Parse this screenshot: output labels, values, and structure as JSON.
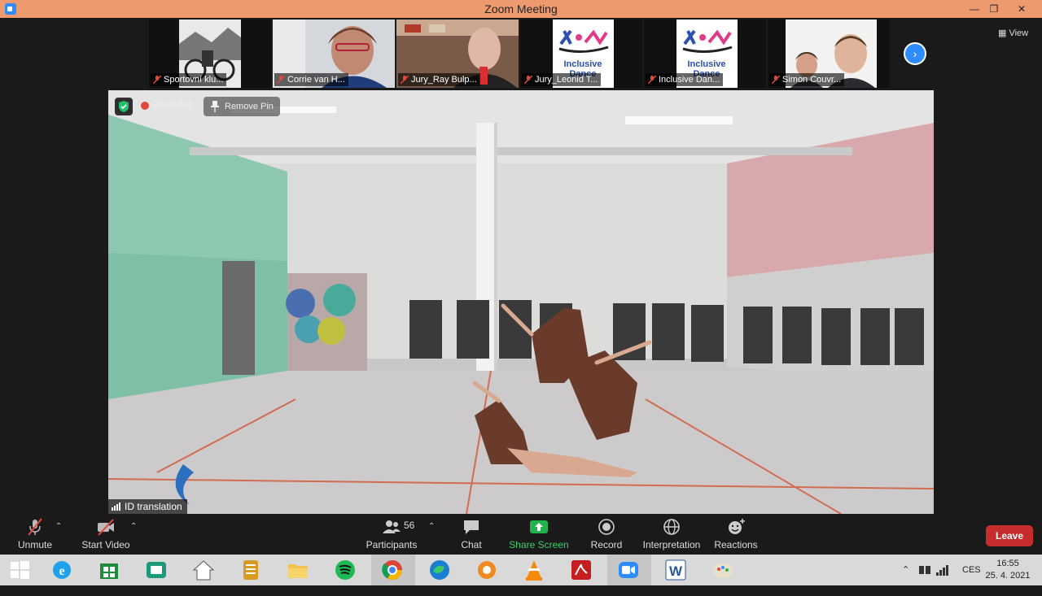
{
  "window": {
    "title": "Zoom Meeting",
    "minimize": "—",
    "restore": "❐",
    "close": "✕"
  },
  "participants_strip": {
    "tiles": [
      {
        "name": "Sportovní klu..."
      },
      {
        "name": "Corrie van H..."
      },
      {
        "name": "Jury_Ray Bulp..."
      },
      {
        "name": "Jury_Leonid T..."
      },
      {
        "name": "Inclusive Dan..."
      },
      {
        "name": "Simon Couvr..."
      }
    ],
    "logo_text": [
      "Inclusive",
      "Dance"
    ],
    "view_label": "View",
    "next_label": "›"
  },
  "main_video": {
    "recording_label": "Recording",
    "remove_pin_label": "Remove Pin",
    "speaker_name": "ID translation"
  },
  "toolbar": {
    "unmute": "Unmute",
    "start_video": "Start Video",
    "participants": "Participants",
    "participants_count": "56",
    "chat": "Chat",
    "share_screen": "Share Screen",
    "record": "Record",
    "interpretation": "Interpretation",
    "reactions": "Reactions",
    "leave": "Leave"
  },
  "taskbar": {
    "language": "CES",
    "time": "16:55",
    "date": "25. 4. 2021"
  },
  "colors": {
    "titlebar": "#ee9a6f",
    "accent": "#2d8cff",
    "share": "#21b34e",
    "leave": "#c62c2c"
  }
}
